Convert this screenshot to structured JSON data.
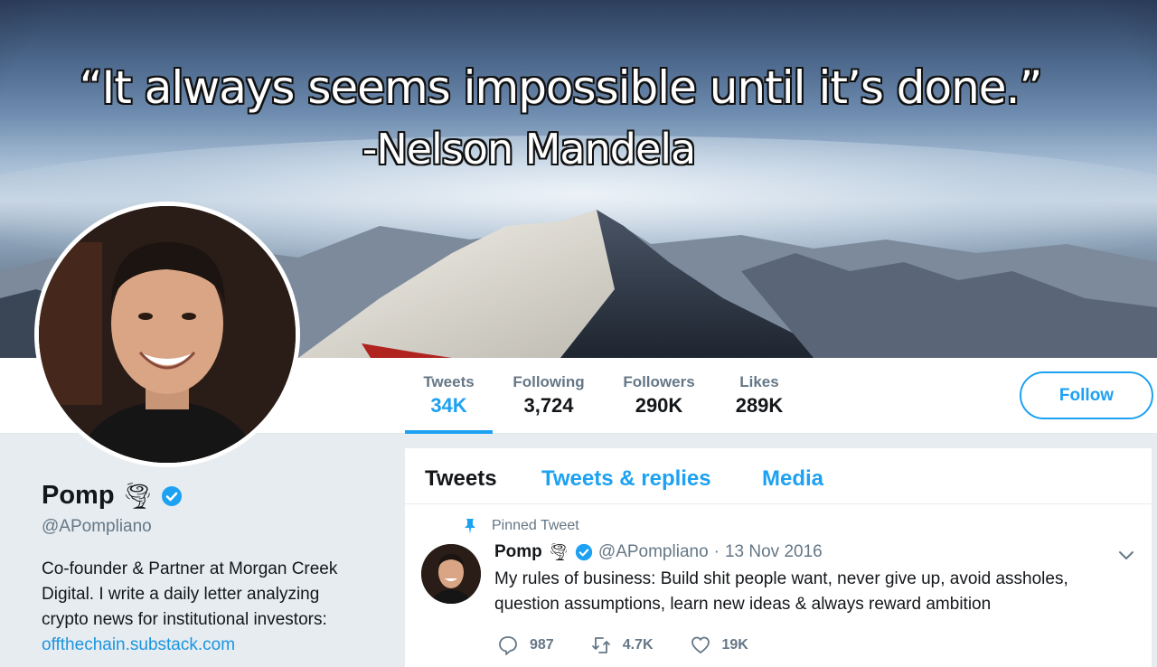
{
  "banner": {
    "quote_line1": "“It always seems impossible until it’s done.”",
    "quote_line2": "-Nelson Mandela"
  },
  "stats": [
    {
      "label": "Tweets",
      "value": "34K"
    },
    {
      "label": "Following",
      "value": "3,724"
    },
    {
      "label": "Followers",
      "value": "290K"
    },
    {
      "label": "Likes",
      "value": "289K"
    }
  ],
  "follow_label": "Follow",
  "profile": {
    "name": "Pomp",
    "name_emoji": "🌪",
    "handle": "@APompliano",
    "bio": "Co-founder & Partner at Morgan Creek Digital. I write a daily letter analyzing crypto news for institutional investors:",
    "link": "offthechain.substack.com"
  },
  "tabs": [
    "Tweets",
    "Tweets & replies",
    "Media"
  ],
  "pinned_tweet": {
    "pinned_label": "Pinned Tweet",
    "name": "Pomp",
    "emoji": "🌪",
    "handle": "@APompliano",
    "separator": "·",
    "date": "13 Nov 2016",
    "text": "My rules of business: Build shit people want, never give up, avoid assholes, question assumptions, learn new ideas & always reward ambition",
    "replies": "987",
    "retweets": "4.7K",
    "likes": "19K"
  },
  "colors": {
    "accent": "#1da1f2",
    "link": "#1b95e0",
    "muted": "#657786",
    "text": "#14171a",
    "page_bg": "#e6ecf0"
  },
  "icons": [
    "verified-badge-icon",
    "pin-icon",
    "chevron-down-icon",
    "reply-icon",
    "retweet-icon",
    "like-icon"
  ]
}
